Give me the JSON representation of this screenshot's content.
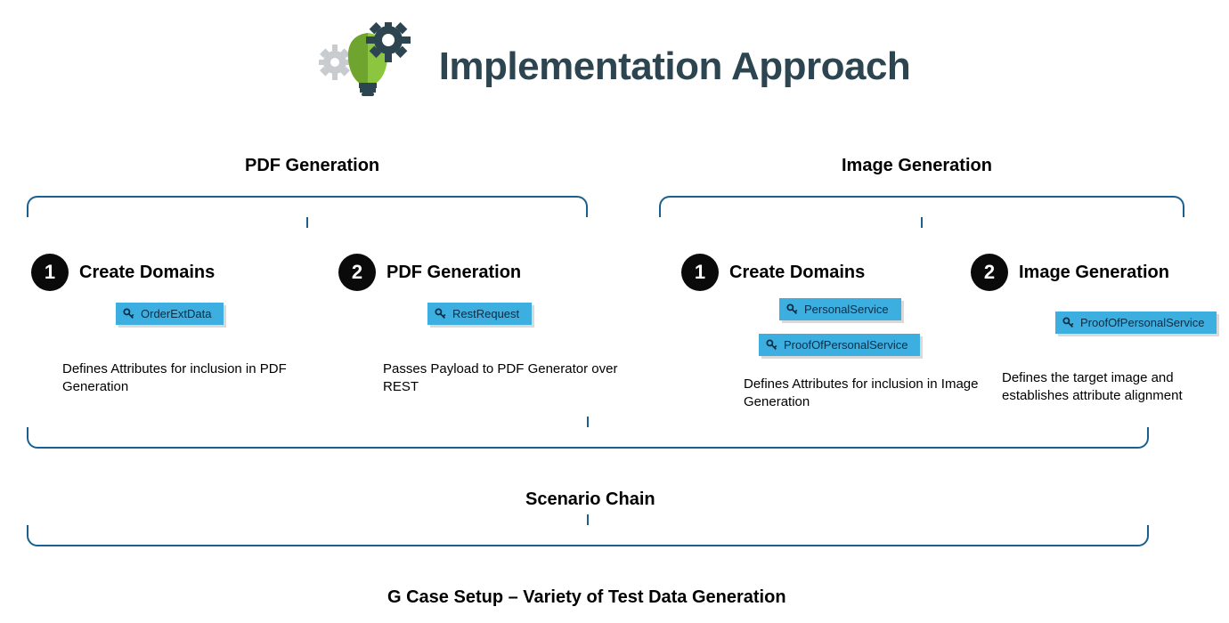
{
  "title": "Implementation Approach",
  "sections": {
    "left": "PDF Generation",
    "right": "Image Generation"
  },
  "steps": {
    "pdf1": {
      "num": "1",
      "title": "Create Domains",
      "chip": "OrderExtData",
      "desc": "Defines Attributes for inclusion in PDF Generation"
    },
    "pdf2": {
      "num": "2",
      "title": "PDF Generation",
      "chip": "RestRequest",
      "desc": "Passes Payload to PDF Generator over REST"
    },
    "img1": {
      "num": "1",
      "title": "Create Domains",
      "chip1": "PersonalService",
      "chip2": "ProofOfPersonalService",
      "desc": "Defines Attributes for inclusion in Image Generation"
    },
    "img2": {
      "num": "2",
      "title": "Image Generation",
      "chip": "ProofOfPersonalService",
      "desc": "Defines the target image and establishes attribute alignment"
    }
  },
  "chain": "Scenario Chain",
  "footer": "G Case Setup – Variety of Test Data Generation"
}
